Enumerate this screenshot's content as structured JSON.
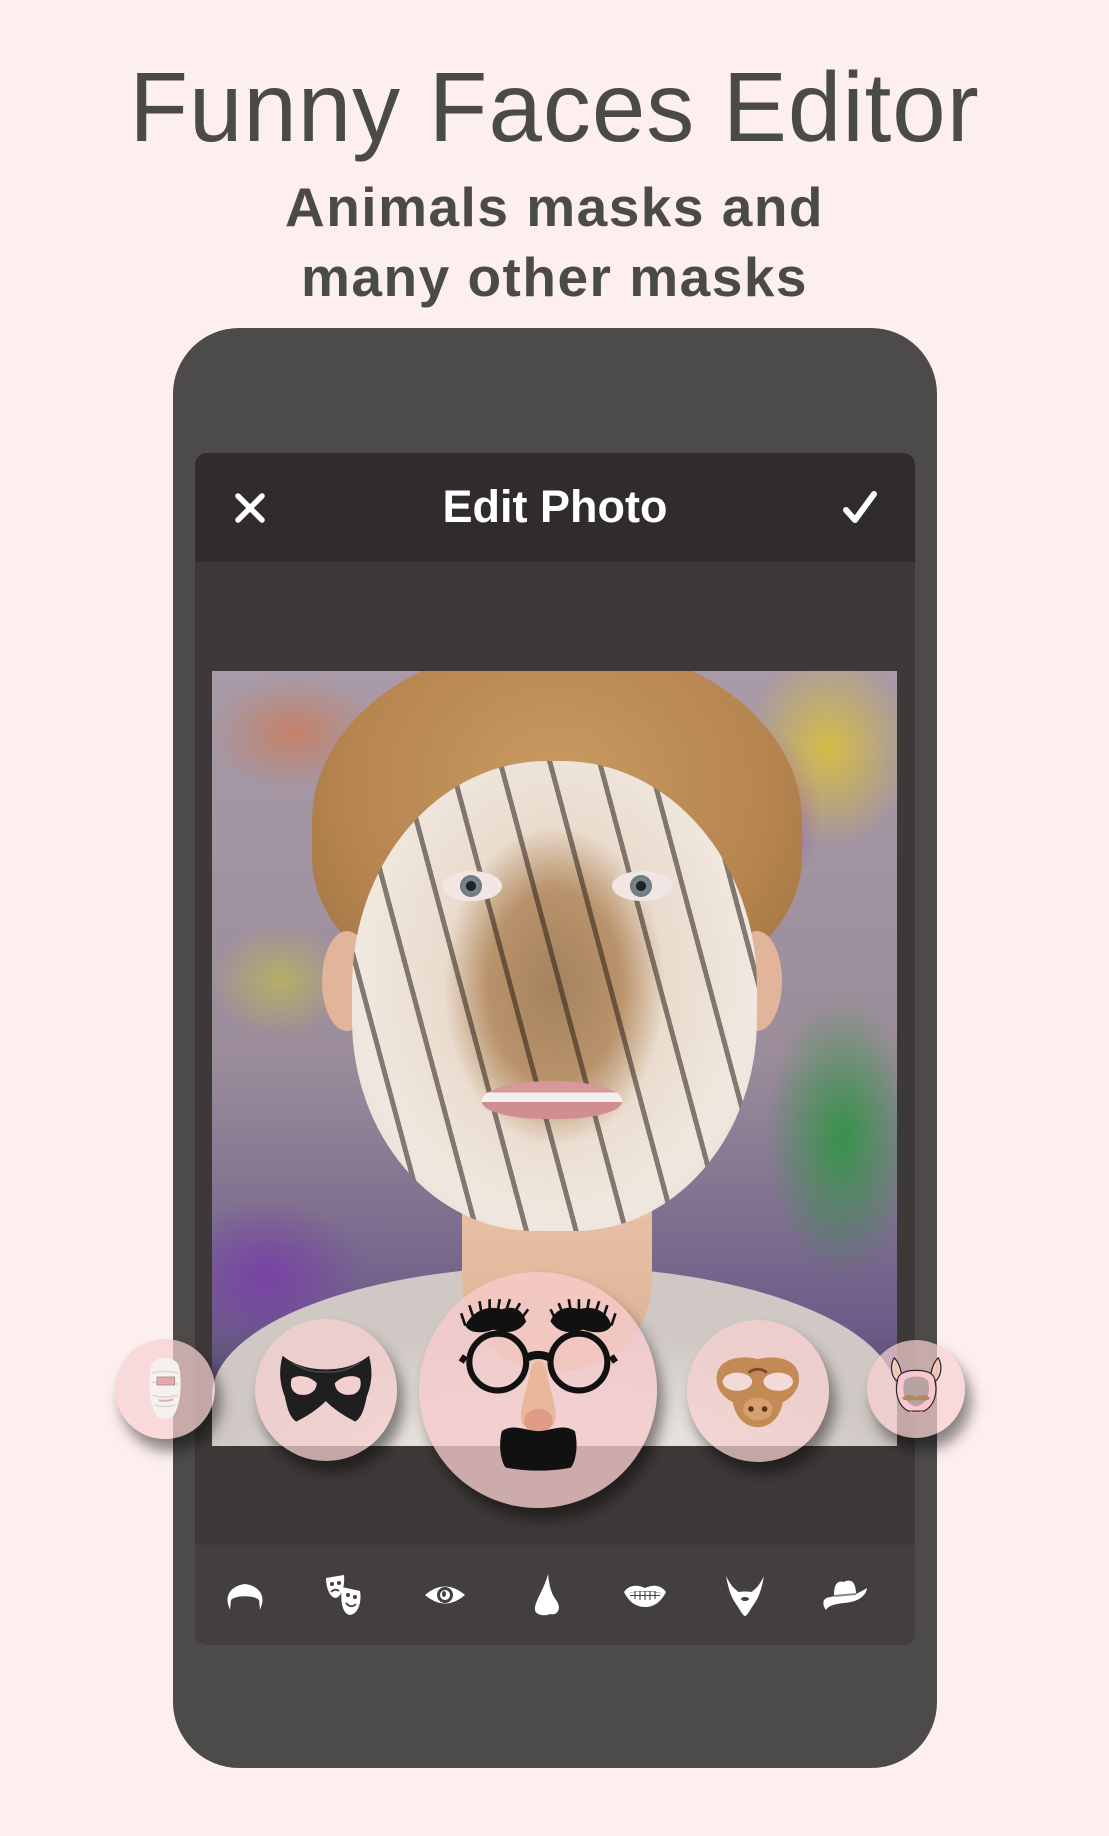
{
  "promo": {
    "title": "Funny Faces Editor",
    "subtitle_line1": "Animals masks and",
    "subtitle_line2": "many other masks"
  },
  "header": {
    "title": "Edit Photo",
    "close_icon": "close-icon",
    "confirm_icon": "checkmark-icon"
  },
  "photo": {
    "description": "Child photo with tiger face mask applied",
    "applied_mask": "tiger"
  },
  "mask_carousel": {
    "selected_index": 2,
    "items": [
      {
        "name": "mummy-bandage-mask",
        "icon": "mummy-mask-icon"
      },
      {
        "name": "black-superhero-eye-mask",
        "icon": "eye-mask-icon"
      },
      {
        "name": "groucho-glasses-nose-mustache",
        "icon": "groucho-glasses-icon"
      },
      {
        "name": "monkey-face-mask",
        "icon": "monkey-face-icon"
      },
      {
        "name": "bunny-hood-mustache",
        "icon": "bunny-hood-icon"
      }
    ]
  },
  "toolbar": {
    "items": [
      {
        "category": "hair",
        "icon": "hair-icon"
      },
      {
        "category": "masks",
        "icon": "theater-masks-icon"
      },
      {
        "category": "eyes",
        "icon": "eye-icon"
      },
      {
        "category": "nose",
        "icon": "nose-icon"
      },
      {
        "category": "mouth",
        "icon": "lips-icon"
      },
      {
        "category": "beard",
        "icon": "beard-icon"
      },
      {
        "category": "hats",
        "icon": "cowboy-hat-icon"
      }
    ]
  },
  "colors": {
    "background": "#fdefef",
    "text": "#4a4a48",
    "phone": "#4d4b4a",
    "header": "#302c2c",
    "screen": "#3e3939",
    "toolbar": "#443f3f",
    "circle": "#f6d0d0"
  }
}
